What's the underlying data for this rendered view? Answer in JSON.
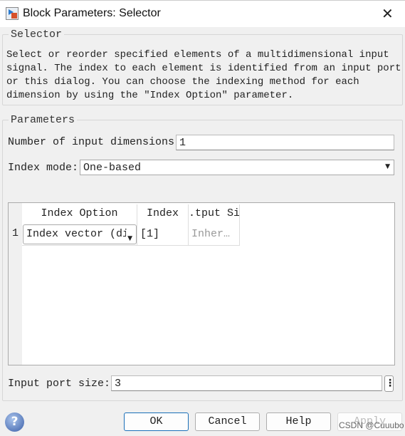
{
  "window": {
    "title": "Block Parameters: Selector",
    "close_icon": "close-icon",
    "app_icon": "simulink-block-icon"
  },
  "description": {
    "legend": "Selector",
    "text": "Select or reorder specified elements of a multidimensional input signal. The index to each element is identified from an input port or this dialog. You can choose the indexing method for each dimension by using the \"Index Option\" parameter."
  },
  "parameters": {
    "legend": "Parameters",
    "num_dims_label": "Number of input dimensions:",
    "num_dims_value": "1",
    "index_mode_label": "Index mode:",
    "index_mode_value": "One-based",
    "table": {
      "headers": [
        "Index Option",
        "Index",
        ".tput Si"
      ],
      "rows": [
        {
          "num": "1",
          "option": "Index vector (di",
          "index": "[1]",
          "output_size": "Inher…"
        }
      ]
    },
    "port_size_label": "Input port size:",
    "port_size_value": "3",
    "more_icon": "vertical-ellipsis-icon"
  },
  "buttons": {
    "ok": "OK",
    "cancel": "Cancel",
    "help": "Help",
    "apply": "Apply",
    "help_icon": "question-mark-icon"
  },
  "watermark": "CSDN @Cuuubo"
}
